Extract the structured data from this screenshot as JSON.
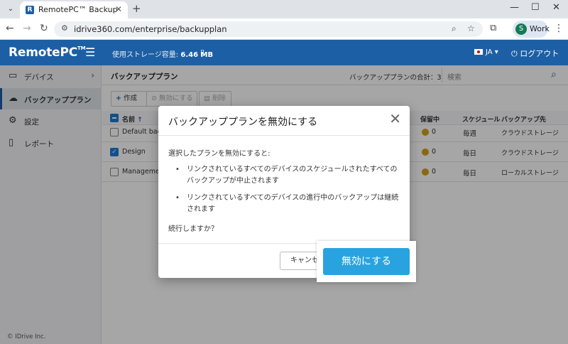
{
  "browser": {
    "tab_title": "RemotePC™ Backup",
    "url": "idrive360.com/enterprise/backupplan",
    "profile_initial": "S",
    "profile_label": "Work"
  },
  "header": {
    "logo": "RemotePC",
    "logo_tm": "TM",
    "storage_label": "使用ストレージ容量: ",
    "storage_value": "6.46 MB",
    "lang": "JA",
    "logout": "ログアウト"
  },
  "sidebar": {
    "items": [
      {
        "label": "デバイス",
        "icon": "devices-icon"
      },
      {
        "label": "バックアッププラン",
        "icon": "cloud-upload-icon"
      },
      {
        "label": "設定",
        "icon": "gear-icon"
      },
      {
        "label": "レポート",
        "icon": "document-icon"
      }
    ],
    "copyright": "© IDrive Inc."
  },
  "main": {
    "title": "バックアッププラン",
    "total_label": "バックアッププランの合計：",
    "total_value": "3",
    "search_placeholder": "検索",
    "toolbar": {
      "create": "作成",
      "disable": "無効にする",
      "delete": "削除"
    },
    "columns": {
      "name": "名前",
      "in_progress": "保留中",
      "schedule": "スケジュール",
      "destination": "バックアップ先"
    },
    "rows": [
      {
        "name": "Default backu",
        "pending": "0",
        "schedule": "毎週",
        "destination": "クラウドストレージ",
        "checked": false
      },
      {
        "name": "Design",
        "pending": "0",
        "schedule": "毎日",
        "destination": "クラウドストレージ",
        "checked": true
      },
      {
        "name": "Management",
        "pending": "0",
        "schedule": "毎日",
        "destination": "ローカルストレージ",
        "checked": false
      }
    ]
  },
  "modal": {
    "title": "バックアッププランを無効にする",
    "intro": "選択したプランを無効にすると:",
    "bullet1": "リンクされているすべてのデバイスのスケジュールされたすべてのバックアップが中止されます",
    "bullet2": "リンクされているすべてのデバイスの進行中のバックアップは継続されます",
    "confirm": "続行しますか？",
    "cancel": "キャンセル",
    "disable": "無効にする"
  },
  "colors": {
    "brand": "#1d5fa4",
    "primary_button": "#29a3df"
  }
}
